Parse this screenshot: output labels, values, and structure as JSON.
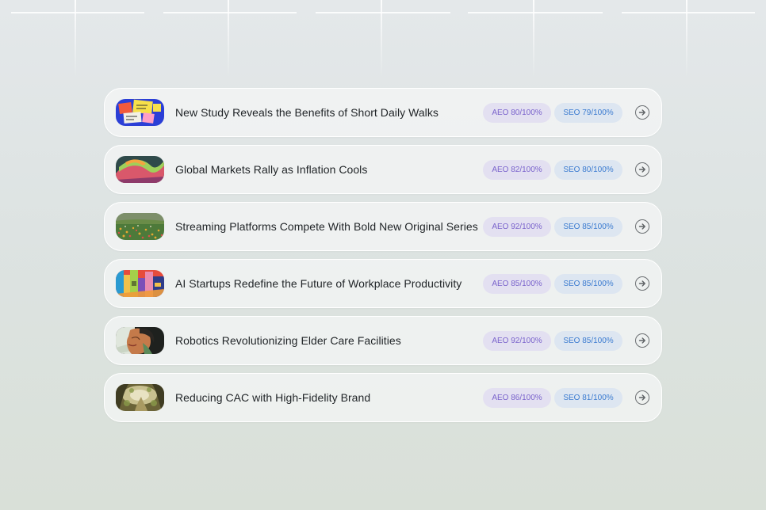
{
  "articles": [
    {
      "title": "New Study Reveals the Benefits of Short Daily Walks",
      "aeo": "AEO 80/100%",
      "seo": "SEO 79/100%",
      "thumb_icon": "sticky-notes-thumbnail"
    },
    {
      "title": "Global Markets Rally as Inflation Cools",
      "aeo": "AEO 82/100%",
      "seo": "SEO 80/100%",
      "thumb_icon": "colorful-ribbon-thumbnail"
    },
    {
      "title": "Streaming Platforms Compete With Bold New Original Series",
      "aeo": "AEO 92/100%",
      "seo": "SEO 85/100%",
      "thumb_icon": "flower-field-thumbnail"
    },
    {
      "title": "AI Startups Redefine the Future of Workplace Productivity",
      "aeo": "AEO 85/100%",
      "seo": "SEO 85/100%",
      "thumb_icon": "abstract-buildings-thumbnail"
    },
    {
      "title": "Robotics Revolutionizing Elder Care Facilities",
      "aeo": "AEO 92/100%",
      "seo": "SEO 85/100%",
      "thumb_icon": "portrait-thumbnail"
    },
    {
      "title": "Reducing CAC with High-Fidelity Brand",
      "aeo": "AEO 86/100%",
      "seo": "SEO 81/100%",
      "thumb_icon": "forest-path-thumbnail"
    }
  ],
  "colors": {
    "aeo_bg": "#e3e0f1",
    "aeo_text": "#7a63cc",
    "seo_bg": "#dde6f1",
    "seo_text": "#3b7bd0"
  }
}
